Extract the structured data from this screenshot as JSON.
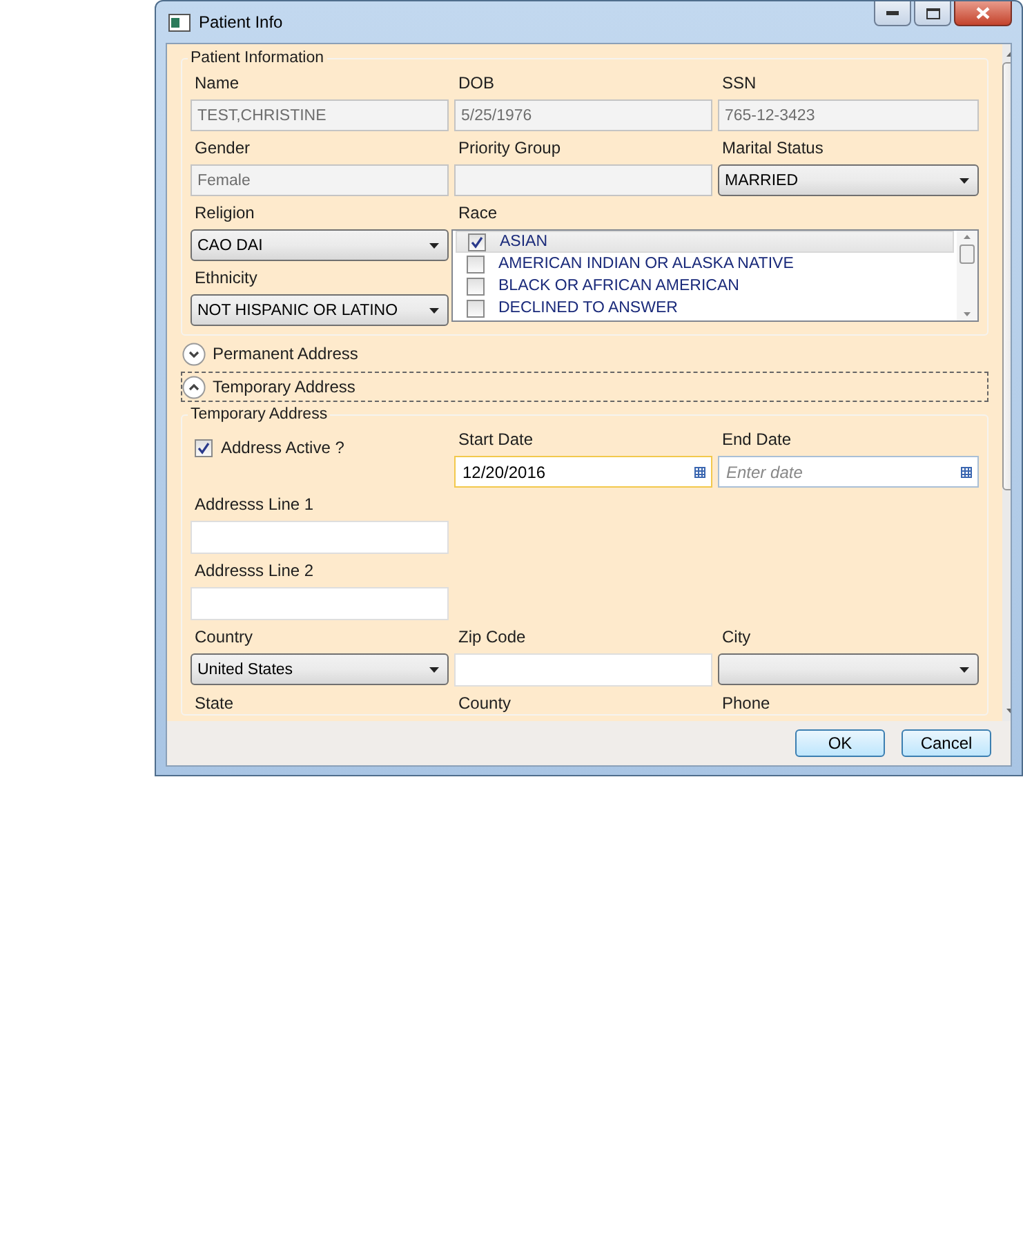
{
  "window": {
    "title": "Patient Info"
  },
  "patient_information": {
    "legend": "Patient Information",
    "rows": [
      [
        {
          "label": "Name",
          "kind": "readonly",
          "value": "TEST,CHRISTINE"
        },
        {
          "label": "DOB",
          "kind": "readonly",
          "value": "5/25/1976"
        },
        {
          "label": "SSN",
          "kind": "readonly",
          "value": "765-12-3423"
        }
      ],
      [
        {
          "label": "Gender",
          "kind": "readonly",
          "value": "Female"
        },
        {
          "label": "Priority Group",
          "kind": "readonly"
        },
        {
          "label": "Marital Status",
          "kind": "dropdown",
          "value": "MARRIED"
        }
      ]
    ],
    "left_column": [
      {
        "label": "Religion",
        "kind": "dropdown",
        "value": "CAO DAI"
      },
      {
        "label": "Ethnicity",
        "kind": "dropdown",
        "value": "NOT HISPANIC OR LATINO"
      }
    ],
    "race": {
      "label": "Race",
      "items": [
        {
          "label": "ASIAN",
          "checked": true,
          "selected": true
        },
        {
          "label": "AMERICAN INDIAN OR ALASKA NATIVE",
          "checked": false,
          "selected": false
        },
        {
          "label": "BLACK OR AFRICAN AMERICAN",
          "checked": false,
          "selected": false
        },
        {
          "label": "DECLINED TO ANSWER",
          "checked": false,
          "selected": false
        }
      ]
    }
  },
  "expanders": [
    {
      "label": "Permanent Address",
      "expanded": false,
      "focused": false
    },
    {
      "label": "Temporary Address",
      "expanded": true,
      "focused": true
    }
  ],
  "temporary_address": {
    "legend": "Temporary Address",
    "address_active": {
      "label": "Address Active ?",
      "checked": true
    },
    "dates": [
      {
        "label": "Start Date",
        "kind": "date",
        "value": "12/20/2016",
        "focused": true
      },
      {
        "label": "End Date",
        "kind": "date",
        "placeholder": "Enter date",
        "focused": false
      }
    ],
    "address_lines": [
      {
        "label": "Addresss Line 1",
        "kind": "text"
      },
      {
        "label": "Addresss Line 2",
        "kind": "text"
      }
    ],
    "rows": [
      [
        {
          "label": "Country",
          "kind": "dropdown",
          "value": "United States"
        },
        {
          "label": "Zip Code",
          "kind": "text"
        },
        {
          "label": "City",
          "kind": "dropdown"
        }
      ]
    ],
    "row_labels": [
      "State",
      "County",
      "Phone"
    ]
  },
  "buttons": [
    "OK",
    "Cancel"
  ]
}
